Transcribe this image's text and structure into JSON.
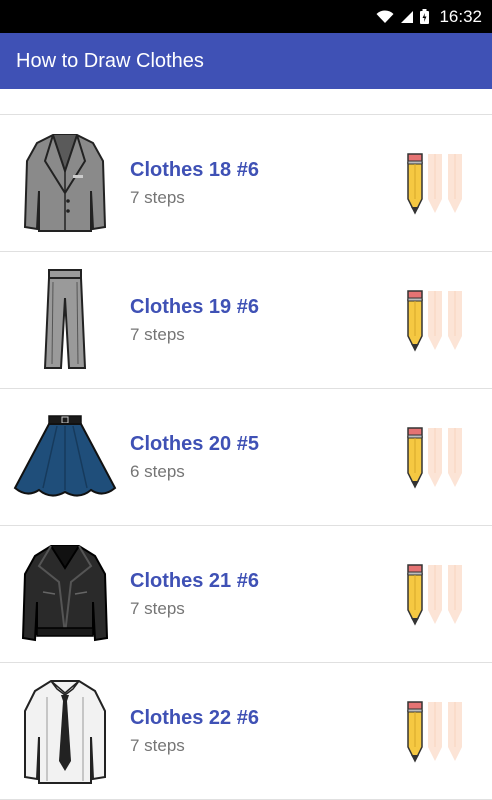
{
  "status_bar": {
    "time": "16:32"
  },
  "app_bar": {
    "title": "How to Draw Clothes"
  },
  "items": [
    {
      "title": "Clothes 18 #6",
      "steps": "7 steps",
      "thumbnail": "suit-jacket",
      "difficulty": 1,
      "difficulty_max": 3
    },
    {
      "title": "Clothes 19 #6",
      "steps": "7 steps",
      "thumbnail": "trousers",
      "difficulty": 1,
      "difficulty_max": 3
    },
    {
      "title": "Clothes 20 #5",
      "steps": "6 steps",
      "thumbnail": "skirt",
      "difficulty": 1,
      "difficulty_max": 3
    },
    {
      "title": "Clothes 21 #6",
      "steps": "7 steps",
      "thumbnail": "leather-jacket",
      "difficulty": 1,
      "difficulty_max": 3
    },
    {
      "title": "Clothes 22 #6",
      "steps": "7 steps",
      "thumbnail": "shirt-and-tie",
      "difficulty": 1,
      "difficulty_max": 3
    }
  ],
  "colors": {
    "primary": "#3F51B5",
    "status_bar": "#000000",
    "pencil_active_body": "#F5C842",
    "pencil_inactive": "#FCE4D6",
    "subtitle": "#757575"
  }
}
